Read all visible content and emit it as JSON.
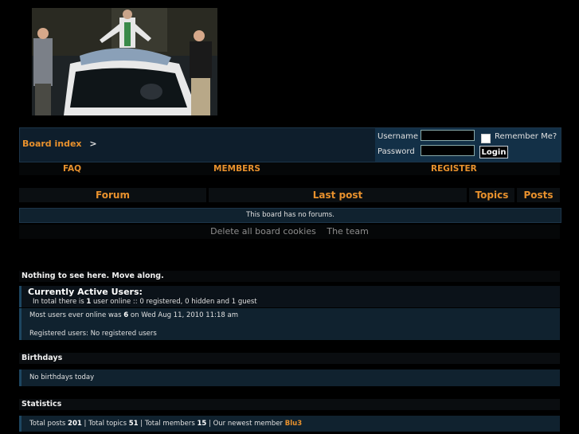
{
  "breadcrumb": {
    "board_index": "Board index",
    "separator": ">"
  },
  "login": {
    "username_label": "Username",
    "password_label": "Password",
    "remember_label": "Remember Me?",
    "login_button": "Login"
  },
  "links": {
    "faq": "FAQ",
    "members": "MEMBERS",
    "register": "REGISTER"
  },
  "forum_table": {
    "col_forum": "Forum",
    "col_last_post": "Last post",
    "col_topics": "Topics",
    "col_posts": "Posts",
    "empty_message": "This board has no forums."
  },
  "footer_links": {
    "delete_cookies": "Delete all board cookies",
    "team": "The team"
  },
  "notice": "Nothing to see here. Move along.",
  "active_users": {
    "title": "Currently Active Users:",
    "total_prefix": "In total there is",
    "total_count": "1",
    "total_suffix": "user online :: 0 registered, 0 hidden and 1 guest",
    "most_prefix": "Most users ever online was",
    "most_count": "6",
    "most_suffix": "on Wed Aug 11, 2010 11:18 am",
    "registered": "Registered users: No registered users"
  },
  "birthdays": {
    "title": "Birthdays",
    "text": "No birthdays today"
  },
  "statistics": {
    "title": "Statistics",
    "posts_label": "Total posts",
    "posts": "201",
    "topics_label": "Total topics",
    "topics": "51",
    "members_label": "Total members",
    "members": "15",
    "newest_label": "Our newest member",
    "newest": "Blu3"
  }
}
